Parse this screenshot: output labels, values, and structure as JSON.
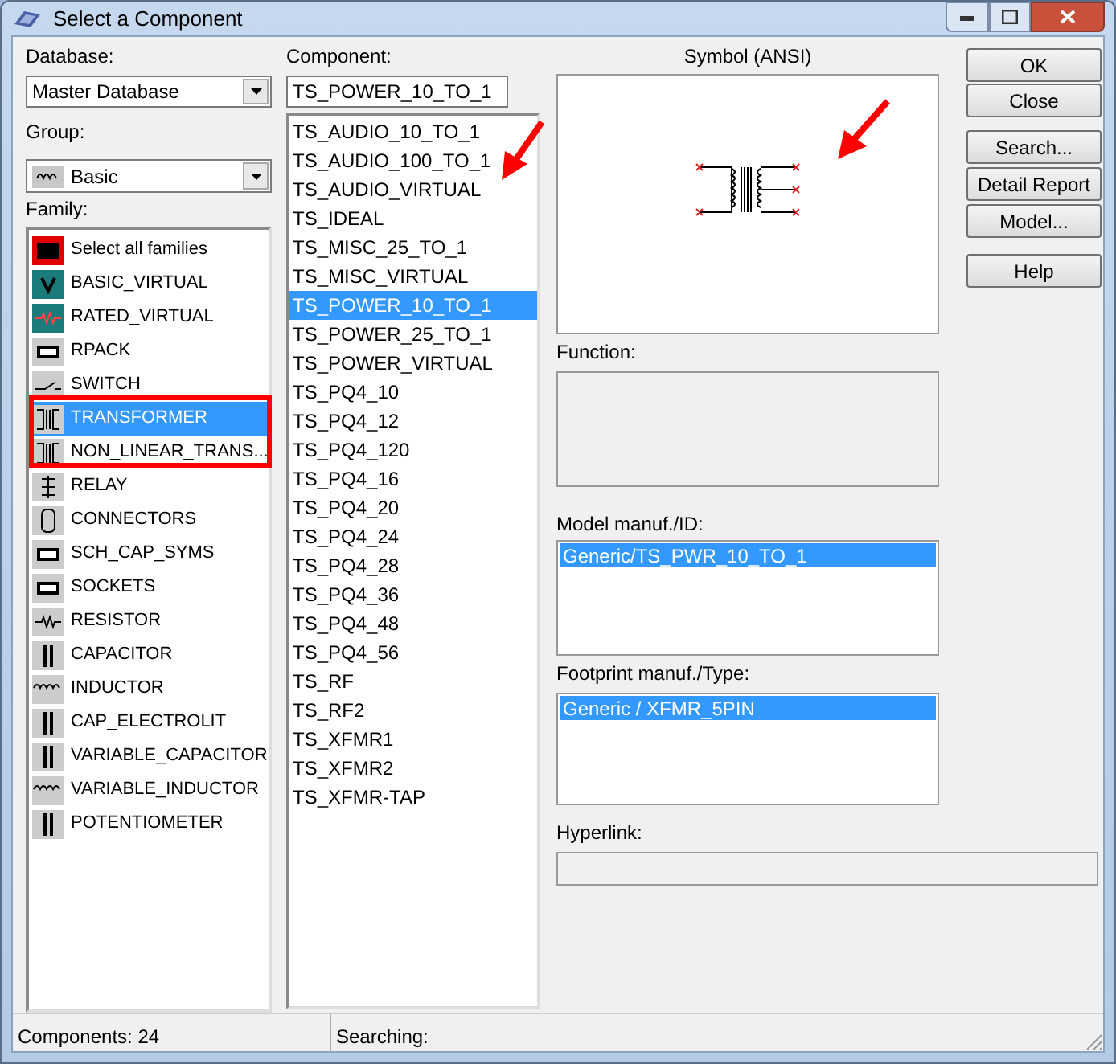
{
  "window": {
    "title": "Select a Component"
  },
  "database": {
    "label": "Database:",
    "value": "Master Database"
  },
  "group": {
    "label": "Group:",
    "value": "Basic"
  },
  "family": {
    "label": "Family:",
    "items": [
      {
        "label": "Select all families",
        "kind": "all",
        "selected": false
      },
      {
        "label": "BASIC_VIRTUAL",
        "kind": "virtual",
        "selected": false
      },
      {
        "label": "RATED_VIRTUAL",
        "kind": "rated",
        "selected": false
      },
      {
        "label": "RPACK",
        "kind": "chip",
        "selected": false
      },
      {
        "label": "SWITCH",
        "kind": "switch",
        "selected": false
      },
      {
        "label": "TRANSFORMER",
        "kind": "transformer",
        "selected": true
      },
      {
        "label": "NON_LINEAR_TRANS...",
        "kind": "transformer",
        "selected": false
      },
      {
        "label": "RELAY",
        "kind": "relay",
        "selected": false
      },
      {
        "label": "CONNECTORS",
        "kind": "connector",
        "selected": false
      },
      {
        "label": "SCH_CAP_SYMS",
        "kind": "chip",
        "selected": false
      },
      {
        "label": "SOCKETS",
        "kind": "chip",
        "selected": false
      },
      {
        "label": "RESISTOR",
        "kind": "resistor",
        "selected": false
      },
      {
        "label": "CAPACITOR",
        "kind": "capacitor",
        "selected": false
      },
      {
        "label": "INDUCTOR",
        "kind": "inductor",
        "selected": false
      },
      {
        "label": "CAP_ELECTROLIT",
        "kind": "capacitor",
        "selected": false
      },
      {
        "label": "VARIABLE_CAPACITOR",
        "kind": "capacitor",
        "selected": false
      },
      {
        "label": "VARIABLE_INDUCTOR",
        "kind": "inductor",
        "selected": false
      },
      {
        "label": "POTENTIOMETER",
        "kind": "capacitor",
        "selected": false
      }
    ]
  },
  "component": {
    "label": "Component:",
    "value": "TS_POWER_10_TO_1",
    "items": [
      {
        "label": "TS_AUDIO_10_TO_1",
        "selected": false
      },
      {
        "label": "TS_AUDIO_100_TO_1",
        "selected": false
      },
      {
        "label": "TS_AUDIO_VIRTUAL",
        "selected": false
      },
      {
        "label": "TS_IDEAL",
        "selected": false
      },
      {
        "label": "TS_MISC_25_TO_1",
        "selected": false
      },
      {
        "label": "TS_MISC_VIRTUAL",
        "selected": false
      },
      {
        "label": "TS_POWER_10_TO_1",
        "selected": true
      },
      {
        "label": "TS_POWER_25_TO_1",
        "selected": false
      },
      {
        "label": "TS_POWER_VIRTUAL",
        "selected": false
      },
      {
        "label": "TS_PQ4_10",
        "selected": false
      },
      {
        "label": "TS_PQ4_12",
        "selected": false
      },
      {
        "label": "TS_PQ4_120",
        "selected": false
      },
      {
        "label": "TS_PQ4_16",
        "selected": false
      },
      {
        "label": "TS_PQ4_20",
        "selected": false
      },
      {
        "label": "TS_PQ4_24",
        "selected": false
      },
      {
        "label": "TS_PQ4_28",
        "selected": false
      },
      {
        "label": "TS_PQ4_36",
        "selected": false
      },
      {
        "label": "TS_PQ4_48",
        "selected": false
      },
      {
        "label": "TS_PQ4_56",
        "selected": false
      },
      {
        "label": "TS_RF",
        "selected": false
      },
      {
        "label": "TS_RF2",
        "selected": false
      },
      {
        "label": "TS_XFMR1",
        "selected": false
      },
      {
        "label": "TS_XFMR2",
        "selected": false
      },
      {
        "label": "TS_XFMR-TAP",
        "selected": false
      }
    ]
  },
  "symbol": {
    "label": "Symbol (ANSI)"
  },
  "function": {
    "label": "Function:"
  },
  "model": {
    "label": "Model manuf./ID:",
    "items": [
      {
        "label": "Generic/TS_PWR_10_TO_1",
        "selected": true
      }
    ]
  },
  "footprint": {
    "label": "Footprint manuf./Type:",
    "items": [
      {
        "label": "Generic / XFMR_5PIN",
        "selected": true
      }
    ]
  },
  "hyperlink": {
    "label": "Hyperlink:"
  },
  "buttons": [
    "OK",
    "Close",
    "Search...",
    "Detail Report",
    "Model...",
    "Help"
  ],
  "status_bar": [
    "Components: 24",
    "Searching:"
  ]
}
